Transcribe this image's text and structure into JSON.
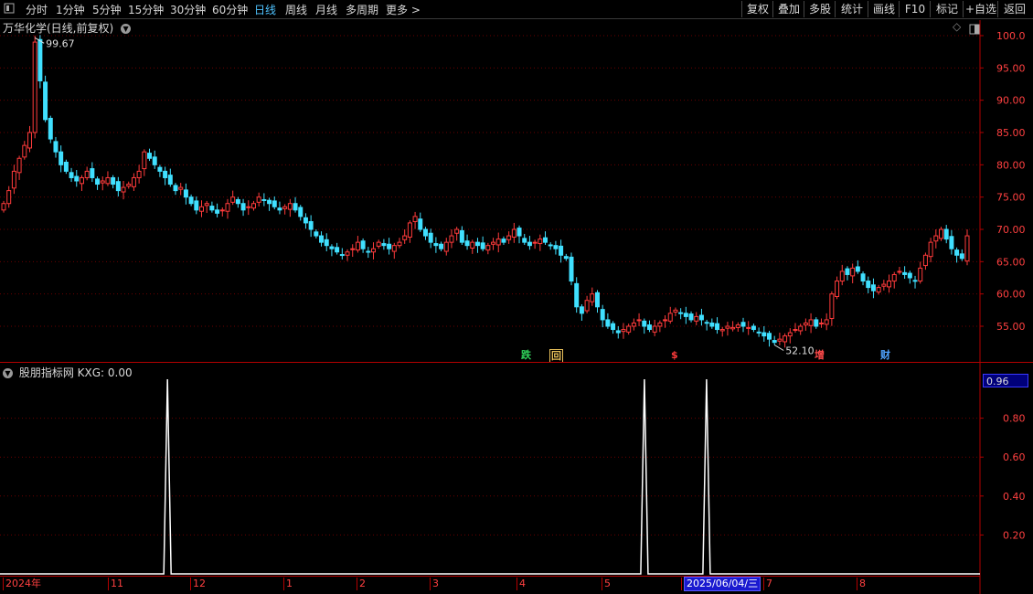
{
  "toolbar": {
    "left_items": [
      {
        "label": "分时",
        "active": false
      },
      {
        "label": "1分钟",
        "active": false
      },
      {
        "label": "5分钟",
        "active": false
      },
      {
        "label": "15分钟",
        "active": false
      },
      {
        "label": "30分钟",
        "active": false
      },
      {
        "label": "60分钟",
        "active": false
      },
      {
        "label": "日线",
        "active": true
      },
      {
        "label": "周线",
        "active": false
      },
      {
        "label": "月线",
        "active": false
      },
      {
        "label": "多周期",
        "active": false
      },
      {
        "label": "更多 >",
        "active": false
      }
    ],
    "right_buttons": [
      "复权",
      "叠加",
      "多股",
      "统计",
      "画线",
      "F10",
      "标记",
      "+自选",
      "返回"
    ]
  },
  "main_panel": {
    "title": "万华化学(日线,前复权)",
    "max_label": "99.67",
    "min_label": "52.10",
    "y_ticks": [
      "100.0",
      "95.00",
      "90.00",
      "85.00",
      "80.00",
      "75.00",
      "70.00",
      "65.00",
      "60.00",
      "55.00"
    ],
    "badges": [
      {
        "text": "跌",
        "color": "#2fd25a"
      },
      {
        "text": "回",
        "color": "#e8c05a"
      },
      {
        "text": "$",
        "color": "#ff3b3b"
      },
      {
        "text": "增",
        "color": "#ff4a4a"
      },
      {
        "text": "财",
        "color": "#4fa3ff"
      }
    ]
  },
  "sub_panel": {
    "title": "股朋指标网 KXG: 0.00",
    "current_value": "0.96",
    "y_ticks": [
      "0.80",
      "0.60",
      "0.40",
      "0.20"
    ]
  },
  "x_axis": {
    "labels": [
      "2024年",
      "11",
      "12",
      "1",
      "2",
      "3",
      "4",
      "5",
      "6",
      "7",
      "8"
    ],
    "cursor_date": "2025/06/04/三"
  },
  "colors": {
    "up": "#ff3b3b",
    "down": "#40e0ff",
    "grid": "#7a0000",
    "axis": "#b30000",
    "indicator_line": "#ffffff"
  },
  "chart_data": {
    "type": "candlestick",
    "price_range": [
      52.1,
      99.67
    ],
    "y_ticks": [
      100,
      95,
      90,
      85,
      80,
      75,
      70,
      65,
      60,
      55
    ],
    "closes": [
      74,
      76,
      79,
      81,
      83,
      85,
      99,
      93,
      87,
      84,
      82,
      80,
      79,
      78,
      77.5,
      78,
      79,
      78,
      77,
      77.5,
      78,
      77,
      76,
      76.5,
      77,
      78,
      79,
      82,
      81,
      80,
      79,
      78,
      77,
      76,
      76.5,
      75,
      74,
      73,
      73.5,
      74,
      73,
      72.5,
      73,
      74,
      75,
      74,
      73,
      73.5,
      74,
      75,
      74.5,
      74,
      73.5,
      73,
      73.5,
      74,
      73,
      72,
      71,
      70,
      69,
      68,
      67.5,
      67,
      66.5,
      66,
      66.5,
      67,
      68,
      67,
      66.5,
      67,
      68,
      67.5,
      67,
      67.5,
      68,
      69,
      71,
      72,
      70,
      69,
      68,
      67.5,
      67,
      68,
      69,
      70,
      68,
      67.5,
      68,
      67.5,
      67,
      67.5,
      68,
      68.5,
      68,
      69,
      70,
      69,
      68,
      67.5,
      68,
      68.5,
      68,
      67.5,
      67,
      66,
      65.5,
      62,
      58,
      57,
      59,
      60,
      58,
      56,
      55,
      54.5,
      54,
      54.5,
      55,
      55.5,
      56,
      55,
      54.5,
      55,
      55.5,
      56,
      57,
      57.5,
      57,
      56.5,
      56,
      56.5,
      56,
      55.5,
      55,
      54.5,
      54.5,
      55,
      54.8,
      55.2,
      55,
      54.8,
      54.5,
      54,
      53.5,
      53,
      52.5,
      53,
      53.5,
      54,
      54.5,
      55,
      55.5,
      56,
      55,
      55.5,
      56,
      60,
      62,
      63.5,
      63,
      64,
      63.5,
      62,
      61,
      60.5,
      61,
      61.5,
      62,
      63,
      63.5,
      63,
      62.5,
      62,
      64,
      66,
      68,
      69,
      70,
      68.5,
      67,
      66,
      65.5,
      69
    ],
    "up_color": "#ff3b3b",
    "down_color": "#40e0ff",
    "indicator": {
      "name": "KXG",
      "value": 0.0,
      "spike_positions": [
        0.17,
        0.665,
        0.7295
      ],
      "y_ticks": [
        0.8,
        0.6,
        0.4,
        0.2
      ]
    }
  }
}
